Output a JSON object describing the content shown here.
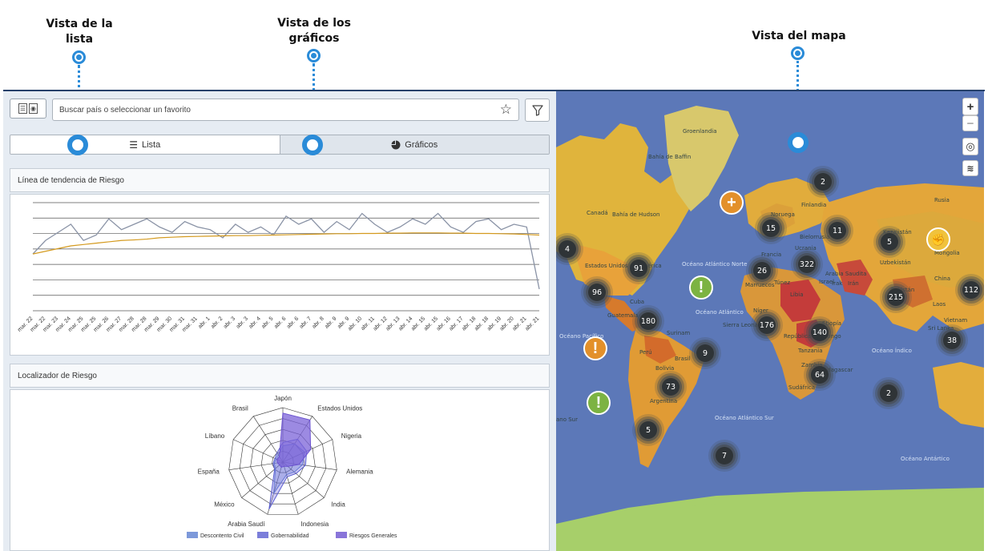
{
  "callouts": {
    "list": {
      "line1": "Vista de la",
      "line2": "lista"
    },
    "charts": {
      "line1": "Vista de los",
      "line2": "gráficos"
    },
    "map": {
      "line1": "Vista del mapa"
    }
  },
  "search": {
    "placeholder": "Buscar país o seleccionar un favorito"
  },
  "tabs": {
    "list_label": "Lista",
    "charts_label": "Gráficos"
  },
  "panels": {
    "trend_title": "Línea de tendencia de Riesgo",
    "radar_title": "Localizador de Riesgo"
  },
  "colors": {
    "accent": "#2a8bd8",
    "gray_line": "#8a93a6",
    "orange_line": "#d49a1e",
    "radar_fill": "#7b63d8",
    "radar_line": "#5d7fd1"
  },
  "chart_data": [
    {
      "type": "line",
      "title": "Línea de tendencia de Riesgo",
      "grid": true,
      "x": [
        "mar. 22",
        "mar. 22",
        "mar. 23",
        "mar. 24",
        "mar. 25",
        "mar. 25",
        "mar. 26",
        "mar. 27",
        "mar. 28",
        "mar. 28",
        "mar. 29",
        "mar. 30",
        "mar. 31",
        "mar. 31",
        "abr. 1",
        "abr. 2",
        "abr. 3",
        "abr. 3",
        "abr. 4",
        "abr. 5",
        "abr. 6",
        "abr. 6",
        "abr. 7",
        "abr. 8",
        "abr. 9",
        "abr. 9",
        "abr. 10",
        "abr. 11",
        "abr. 12",
        "abr. 13",
        "abr. 14",
        "abr. 15",
        "abr. 15",
        "abr. 16",
        "abr. 17",
        "abr. 18",
        "abr. 18",
        "abr. 19",
        "abr. 20",
        "abr. 21",
        "abr. 21"
      ],
      "series": [
        {
          "values": [
            2.1,
            2.6,
            2.9,
            3.2,
            2.6,
            2.8,
            3.4,
            3.0,
            3.2,
            3.4,
            3.1,
            2.9,
            3.3,
            3.1,
            3.0,
            2.7,
            3.2,
            2.9,
            3.1,
            2.8,
            3.5,
            3.2,
            3.4,
            2.9,
            3.3,
            3.0,
            3.6,
            3.2,
            2.9,
            3.1,
            3.4,
            3.2,
            3.6,
            3.1,
            2.9,
            3.3,
            3.4,
            3.0,
            3.2,
            3.1,
            0.8
          ]
        },
        {
          "values": [
            2.1,
            2.2,
            2.3,
            2.4,
            2.45,
            2.5,
            2.55,
            2.6,
            2.62,
            2.65,
            2.7,
            2.72,
            2.74,
            2.75,
            2.76,
            2.77,
            2.78,
            2.78,
            2.79,
            2.8,
            2.81,
            2.82,
            2.83,
            2.84,
            2.85,
            2.85,
            2.86,
            2.86,
            2.87,
            2.87,
            2.88,
            2.88,
            2.88,
            2.87,
            2.87,
            2.86,
            2.86,
            2.85,
            2.84,
            2.82,
            2.8
          ]
        }
      ],
      "ylim": [
        0,
        4
      ]
    },
    {
      "type": "radar",
      "title": "Localizador de Riesgo",
      "categories": [
        "Japón",
        "Estados Unidos",
        "Nigeria",
        "Alemania",
        "India",
        "Indonesia",
        "Arabia Saudí",
        "México",
        "España",
        "Líbano",
        "Brasil"
      ],
      "series": [
        {
          "name": "Descontento Civil",
          "values": [
            1.5,
            2.0,
            2.2,
            1.8,
            1.4,
            1.2,
            3.0,
            0.9,
            0.8,
            0.7,
            0.8
          ]
        },
        {
          "name": "Gobernabilidad",
          "values": [
            1.8,
            2.5,
            2.4,
            2.1,
            1.6,
            1.4,
            4.5,
            1.0,
            0.9,
            0.8,
            1.0
          ]
        },
        {
          "name": "Riesgos Generales",
          "values": [
            4.5,
            4.6,
            2.8,
            1.5,
            0.6,
            0.4,
            0.5,
            0.4,
            0.5,
            0.6,
            0.6
          ]
        }
      ],
      "legend": "bottom",
      "rmax": 5
    }
  ],
  "map": {
    "labels": [
      "Groenlandia",
      "Bahía de Baffin",
      "Canadá",
      "Bahía de Hudson",
      "Estados Unidos de América",
      "Cuba",
      "Guatemala",
      "Surinam",
      "Perú",
      "Brasil",
      "Bolivia",
      "Argentina",
      "Océano Atlántico Norte",
      "Océano Atlántico",
      "Océano Pacífico",
      "Océano Atlántico Sur",
      "Océano Índico",
      "Océano Antártico",
      "Noruega",
      "Finlandia",
      "Bielorrusia",
      "Ucrania",
      "Francia",
      "Marruecos",
      "Túnez",
      "Libia",
      "Níger",
      "Sierra Leona",
      "Israel",
      "Irak",
      "Irán",
      "Kazajistán",
      "Uzbekistán",
      "Pakistán",
      "Arabia Saudita",
      "Etiopía",
      "República del Congo",
      "Tanzania",
      "Zambia",
      "Madagascar",
      "Sudáfrica",
      "Rusia",
      "Mongolia",
      "China",
      "Laos",
      "Vietnam",
      "Sri Lanka",
      "ano Sur"
    ],
    "clusters": [
      "2",
      "15",
      "11",
      "5",
      "4",
      "91",
      "26",
      "322",
      "96",
      "215",
      "112",
      "180",
      "176",
      "140",
      "38",
      "9",
      "64",
      "73",
      "2",
      "5",
      "7"
    ],
    "zoom_in": "+",
    "zoom_out": "−"
  }
}
